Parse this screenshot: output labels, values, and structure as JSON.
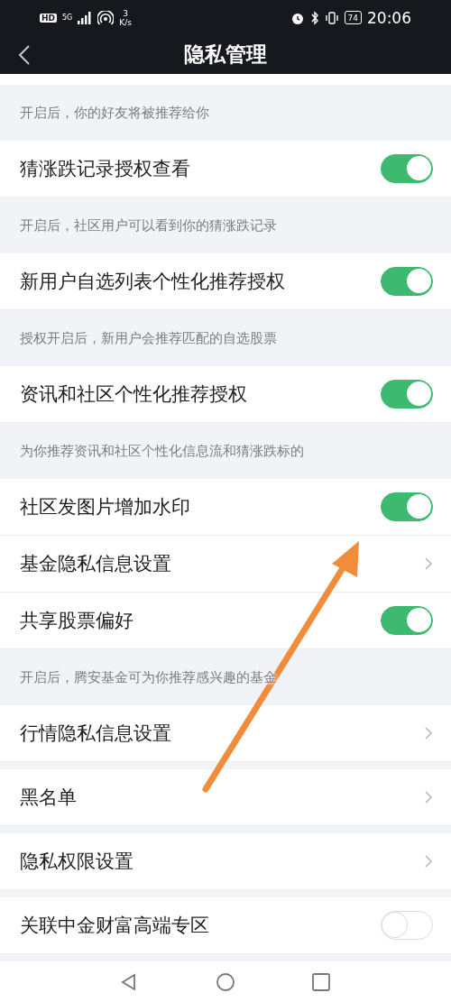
{
  "status_bar": {
    "hd": "HD",
    "network": "5G",
    "data_rate": "3",
    "data_unit": "K/s",
    "battery": "74",
    "time": "20:06"
  },
  "nav": {
    "title": "隐私管理"
  },
  "groups": [
    {
      "note": "开启后，你的好友将被推荐给你"
    },
    {
      "rows": [
        {
          "kind": "toggle",
          "label": "猜涨跌记录授权查看",
          "on": true
        }
      ],
      "note": "开启后，社区用户可以看到你的猜涨跌记录"
    },
    {
      "rows": [
        {
          "kind": "toggle",
          "label": "新用户自选列表个性化推荐授权",
          "on": true
        }
      ],
      "note": "授权开启后，新用户会推荐匹配的自选股票"
    },
    {
      "rows": [
        {
          "kind": "toggle",
          "label": "资讯和社区个性化推荐授权",
          "on": true
        }
      ],
      "note": "为你推荐资讯和社区个性化信息流和猜涨跌标的"
    },
    {
      "rows": [
        {
          "kind": "toggle",
          "label": "社区发图片增加水印",
          "on": true
        },
        {
          "kind": "link",
          "label": "基金隐私信息设置"
        },
        {
          "kind": "toggle",
          "label": "共享股票偏好",
          "on": true
        }
      ],
      "note": "开启后，腾安基金可为你推荐感兴趣的基金"
    },
    {
      "rows": [
        {
          "kind": "link",
          "label": "行情隐私信息设置"
        }
      ]
    },
    {
      "rows": [
        {
          "kind": "link",
          "label": "黑名单"
        }
      ]
    },
    {
      "rows": [
        {
          "kind": "link",
          "label": "隐私权限设置"
        }
      ]
    },
    {
      "rows": [
        {
          "kind": "toggle",
          "label": "关联中金财富高端专区",
          "on": false
        }
      ]
    }
  ]
}
